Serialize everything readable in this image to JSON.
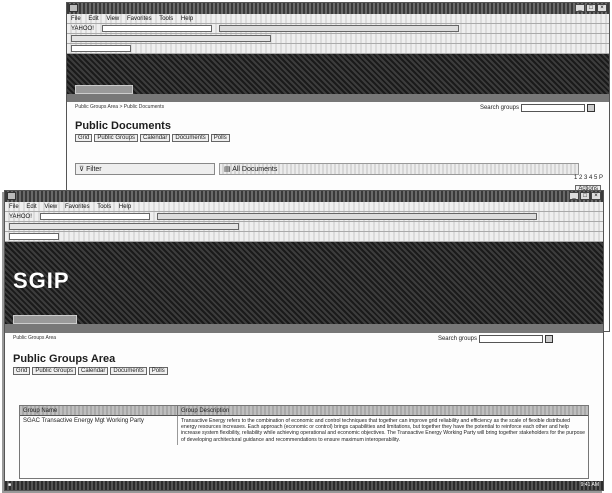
{
  "back_window": {
    "title": "",
    "url_bar": "",
    "menu": [
      "File",
      "Edit",
      "View",
      "Favorites",
      "Tools",
      "Help"
    ],
    "toolbar_search_brand": "YAHOO!",
    "breadcrumb": "Public Groups Area > Public Documents",
    "search_label": "Search groups",
    "page_title": "Public Documents",
    "tabs": [
      "Grid",
      "Public Groups",
      "Calendar",
      "Documents",
      "Polls"
    ],
    "filter_label": "Filter",
    "all_docs_label": "All Documents",
    "pager_text": "1 2 3 4 5 P",
    "action_label": "Actions"
  },
  "front_window": {
    "title": "",
    "menu": [
      "File",
      "Edit",
      "View",
      "Favorites",
      "Tools",
      "Help"
    ],
    "toolbar_search_brand": "YAHOO!",
    "banner_logo": "SGIP",
    "breadcrumb": "Public Groups Area",
    "search_label": "Search groups",
    "page_title": "Public Groups Area",
    "tabs": [
      "Grid",
      "Public Groups",
      "Calendar",
      "Documents",
      "Polls"
    ],
    "table": {
      "columns": [
        "Group Name",
        "Group Description"
      ],
      "rows": [
        {
          "name": "SGAC Transactive Energy Mgt Working Party",
          "description": "Transactive Energy refers to the combination of economic and control techniques that together can improve grid reliability and efficiency as the scale of flexible distributed energy resources increases. Each approach (economic or control) brings capabilities and limitations, but together they have the potential to reinforce each other and help increase system flexibility, reliability while achieving operational and economic objectives. The Transactive Energy Working Party will bring together stakeholders for the purpose of developing architectural guidance and recommendations to ensure maximum interoperability."
        }
      ]
    },
    "status_clock": "9:41 AM"
  }
}
